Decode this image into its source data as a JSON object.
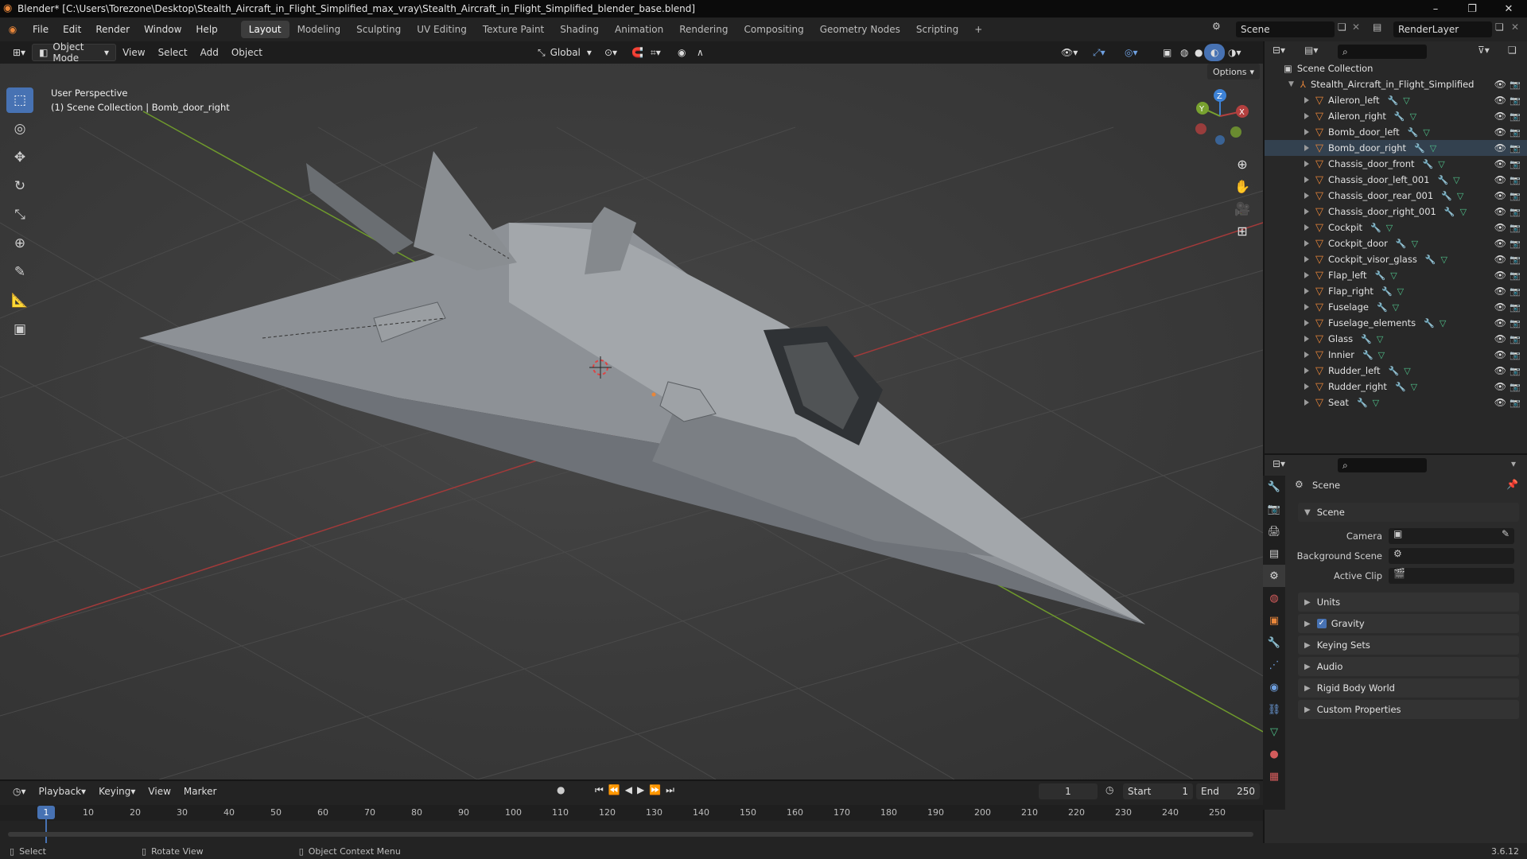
{
  "window": {
    "title": "Blender* [C:\\Users\\Torezone\\Desktop\\Stealth_Aircraft_in_Flight_Simplified_max_vray\\Stealth_Aircraft_in_Flight_Simplified_blender_base.blend]"
  },
  "menu": {
    "items": [
      "File",
      "Edit",
      "Render",
      "Window",
      "Help"
    ]
  },
  "workspaces": [
    "Layout",
    "Modeling",
    "Sculpting",
    "UV Editing",
    "Texture Paint",
    "Shading",
    "Animation",
    "Rendering",
    "Compositing",
    "Geometry Nodes",
    "Scripting",
    "+"
  ],
  "active_workspace": "Layout",
  "scene_selector": "Scene",
  "view_layer": "RenderLayer",
  "viewport_header": {
    "mode": "Object Mode",
    "menus": [
      "View",
      "Select",
      "Add",
      "Object"
    ],
    "orientation": "Global",
    "options_label": "Options"
  },
  "viewport": {
    "perspective": "User Perspective",
    "context": "(1) Scene Collection | Bomb_door_right",
    "gizmo": {
      "x": "X",
      "y": "Y",
      "z": "Z"
    }
  },
  "outliner": {
    "root": "Scene Collection",
    "collection": "Stealth_Aircraft_in_Flight_Simplified",
    "items": [
      {
        "name": "Aileron_left"
      },
      {
        "name": "Aileron_right"
      },
      {
        "name": "Bomb_door_left"
      },
      {
        "name": "Bomb_door_right"
      },
      {
        "name": "Chassis_door_front"
      },
      {
        "name": "Chassis_door_left_001"
      },
      {
        "name": "Chassis_door_rear_001"
      },
      {
        "name": "Chassis_door_right_001"
      },
      {
        "name": "Cockpit"
      },
      {
        "name": "Cockpit_door"
      },
      {
        "name": "Cockpit_visor_glass"
      },
      {
        "name": "Flap_left"
      },
      {
        "name": "Flap_right"
      },
      {
        "name": "Fuselage"
      },
      {
        "name": "Fuselage_elements"
      },
      {
        "name": "Glass"
      },
      {
        "name": "Innier"
      },
      {
        "name": "Rudder_left"
      },
      {
        "name": "Rudder_right"
      },
      {
        "name": "Seat"
      }
    ]
  },
  "properties": {
    "context": "Scene",
    "panel": "Scene",
    "fields": [
      {
        "label": "Camera"
      },
      {
        "label": "Background Scene"
      },
      {
        "label": "Active Clip"
      }
    ],
    "sections": [
      "Units",
      "Gravity",
      "Keying Sets",
      "Audio",
      "Rigid Body World",
      "Custom Properties"
    ],
    "gravity_checked": true
  },
  "timeline": {
    "menus": [
      "Playback",
      "Keying",
      "View",
      "Marker"
    ],
    "current_frame": "1",
    "start_label": "Start",
    "start": "1",
    "end_label": "End",
    "end": "250",
    "ruler": [
      "10",
      "20",
      "30",
      "40",
      "50",
      "60",
      "70",
      "80",
      "90",
      "100",
      "110",
      "120",
      "130",
      "140",
      "150",
      "160",
      "170",
      "180",
      "190",
      "200",
      "210",
      "220",
      "230",
      "240",
      "250"
    ],
    "cursor_frame": "1"
  },
  "statusbar": {
    "select": "Select",
    "rotate": "Rotate View",
    "context_menu": "Object Context Menu",
    "version": "3.6.12"
  },
  "colors": {
    "accent": "#4772b3",
    "mesh_icon": "#e8863a",
    "x_axis": "#b3403f",
    "y_axis": "#78a12f",
    "z_axis": "#3d82d6"
  }
}
